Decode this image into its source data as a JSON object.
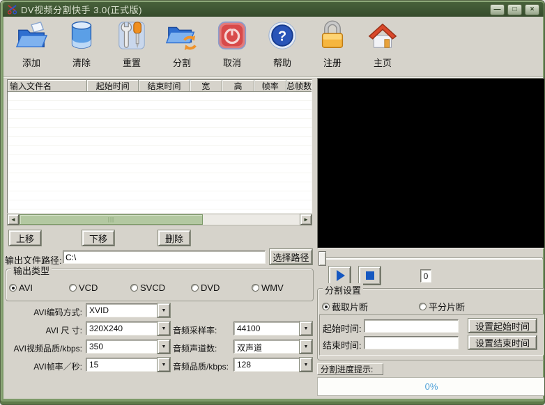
{
  "colors": {
    "titlebar_green": "#3c5433",
    "window_border_green": "#7d9a69",
    "client_gray": "#d6d3cb",
    "progress_text_blue": "#4da0d8",
    "scrollbar_thumb_green": "#b3c8a1",
    "media_icon_blue": "#1557c0"
  },
  "window": {
    "title": "DV视频分割快手 3.0(正式版)",
    "controls": {
      "minimize": "—",
      "maximize": "□",
      "close": "×"
    }
  },
  "toolbar": {
    "items": [
      {
        "label": "添加",
        "icon": "add-folder-icon"
      },
      {
        "label": "清除",
        "icon": "clear-icon"
      },
      {
        "label": "重置",
        "icon": "reset-tools-icon"
      },
      {
        "label": "分割",
        "icon": "split-folder-icon"
      },
      {
        "label": "取消",
        "icon": "cancel-power-icon"
      },
      {
        "label": "帮助",
        "icon": "help-question-icon"
      },
      {
        "label": "注册",
        "icon": "register-lock-icon"
      },
      {
        "label": "主页",
        "icon": "home-house-icon"
      }
    ]
  },
  "file_table": {
    "columns": [
      "输入文件名",
      "起始时间",
      "结束时间",
      "宽",
      "高",
      "帧率",
      "总帧数"
    ],
    "rows": []
  },
  "list_buttons": {
    "move_up": "上移",
    "move_down": "下移",
    "delete": "删除"
  },
  "output_path": {
    "label": "输出文件路径:",
    "value": "C:\\",
    "browse_button": "选择路径"
  },
  "output_type": {
    "group_label": "输出类型",
    "options": [
      {
        "label": "AVI",
        "selected": true
      },
      {
        "label": "VCD",
        "selected": false
      },
      {
        "label": "SVCD",
        "selected": false
      },
      {
        "label": "DVD",
        "selected": false
      },
      {
        "label": "WMV",
        "selected": false
      }
    ]
  },
  "encoding_settings": {
    "left": [
      {
        "label": "AVI编码方式:",
        "value": "XVID"
      },
      {
        "label": "AVI 尺 寸:",
        "value": "320X240"
      },
      {
        "label": "AVI视频品质/kbps:",
        "value": "350"
      },
      {
        "label": "AVI帧率／秒:",
        "value": "15"
      }
    ],
    "right": [
      {
        "label": "音频采样率:",
        "value": "44100"
      },
      {
        "label": "音频声道数:",
        "value": "双声道"
      },
      {
        "label": "音频品质/kbps:",
        "value": "128"
      }
    ]
  },
  "player": {
    "counter": "0",
    "scrollbar_grip": "|||",
    "left_arrow": "◄",
    "right_arrow": "►",
    "combo_arrow": "▼"
  },
  "split_settings": {
    "group_label": "分割设置",
    "modes": [
      {
        "label": "截取片断",
        "selected": true
      },
      {
        "label": "平分片断",
        "selected": false
      }
    ],
    "start_time": {
      "label": "起始时间:",
      "value": "",
      "button": "设置起始时间"
    },
    "end_time": {
      "label": "结束时间:",
      "value": "",
      "button": "设置结束时间"
    }
  },
  "progress": {
    "label": "分割进度提示:",
    "percent": "0%"
  }
}
